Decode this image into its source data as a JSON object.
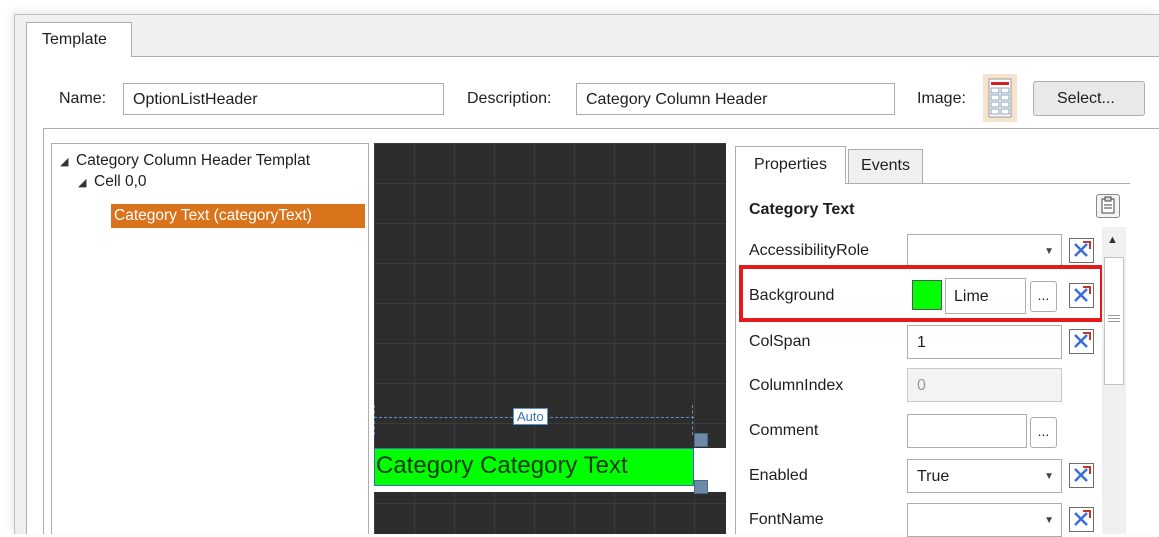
{
  "tabs": {
    "template_label": "Template"
  },
  "header": {
    "name_label": "Name:",
    "name_value": "OptionListHeader",
    "description_label": "Description:",
    "description_value": "Category Column Header",
    "image_label": "Image:",
    "select_button": "Select..."
  },
  "tree": {
    "root": "Category Column Header Templat",
    "cell": "Cell 0,0",
    "selected": "Category Text (categoryText)"
  },
  "canvas": {
    "auto_label": "Auto",
    "cell_text": "Category Category Text",
    "cell_background": "#00ff00"
  },
  "properties": {
    "tabs": [
      "Properties",
      "Events"
    ],
    "heading": "Category Text",
    "rows": [
      {
        "label": "AccessibilityRole",
        "value": "",
        "type": "dropdown"
      },
      {
        "label": "Background",
        "value": "Lime",
        "type": "color",
        "swatch": "#00ff00"
      },
      {
        "label": "ColSpan",
        "value": "1",
        "type": "text"
      },
      {
        "label": "ColumnIndex",
        "value": "0",
        "type": "disabled"
      },
      {
        "label": "Comment",
        "value": "",
        "type": "ellipsis"
      },
      {
        "label": "Enabled",
        "value": "True",
        "type": "dropdown"
      },
      {
        "label": "FontName",
        "value": "",
        "type": "dropdown"
      }
    ],
    "highlight_color": "#e31b1b"
  },
  "colors": {
    "selection": "#d9731c",
    "guide": "#5b8fc9",
    "canvas_bg": "#2d2d2d"
  }
}
